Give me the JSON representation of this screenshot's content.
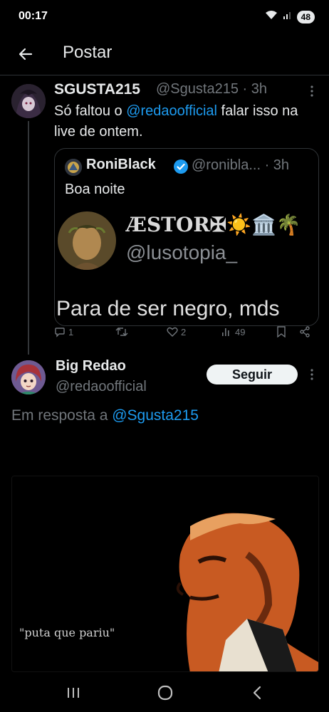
{
  "status_bar": {
    "time": "00:17",
    "battery": "48",
    "icons": [
      "wifi-icon",
      "signal-icon"
    ]
  },
  "header": {
    "title": "Postar",
    "back_icon": "arrow-left-icon"
  },
  "tweet": {
    "name": "SGUSTA215",
    "handle_time": "@Sgusta215 · 3h",
    "text_before": "Só faltou o ",
    "mention": "@redaoofficial",
    "text_after": " falar isso na live de ontem."
  },
  "quoted": {
    "name": "RoniBlack",
    "handle_time": "@ronibla... · 3h",
    "text": "Boa noite",
    "image": {
      "display_name": "ÆSTOR✠☀️🏛️🌴",
      "handle": "@lusotopia_",
      "caption": "Para de ser negro, mds"
    }
  },
  "actions": {
    "replies": "1",
    "retweets": "",
    "likes": "2",
    "views": "49"
  },
  "reply": {
    "name": "Big Redao",
    "handle": "@redaoofficial",
    "follow_label": "Seguir",
    "reply_prefix": "Em resposta a ",
    "reply_target": "@Sgusta215",
    "media_caption": "\"puta que pariu\""
  },
  "colors": {
    "accent": "#1d9bf0",
    "muted": "#71767b",
    "text": "#e7e9ea",
    "background": "#000000"
  }
}
